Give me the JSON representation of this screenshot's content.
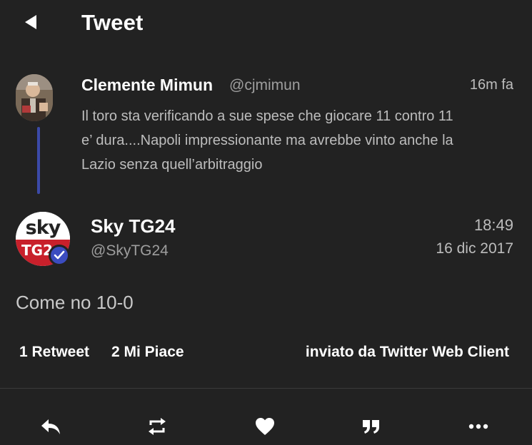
{
  "header": {
    "title": "Tweet"
  },
  "parent_tweet": {
    "name": "Clemente Mimun",
    "handle": "@cjmimun",
    "time": "16m fa",
    "text": "Il toro sta verificando a sue spese che giocare  11 contro 11\ne’ dura....Napoli impressionante ma avrebbe vinto anche la\nLazio senza quell’arbitraggio"
  },
  "main_tweet": {
    "avatar_top": "sky",
    "avatar_bottom": "TG2",
    "name": "Sky TG24",
    "handle": "@SkyTG24",
    "time": "18:49",
    "date": "16 dic 2017",
    "text": "Come no 10-0"
  },
  "stats": {
    "retweets": "1 Retweet",
    "likes": "2 Mi Piace",
    "source": "inviato da Twitter Web Client"
  },
  "actions": [
    {
      "icon": "reply-icon"
    },
    {
      "icon": "retweet-icon"
    },
    {
      "icon": "heart-icon"
    },
    {
      "icon": "quote-icon"
    },
    {
      "icon": "more-icon"
    }
  ],
  "colors": {
    "background": "#222222",
    "thread_line": "#3b4aa8",
    "verified": "#3b4cc0",
    "sky_red": "#c8202b"
  }
}
